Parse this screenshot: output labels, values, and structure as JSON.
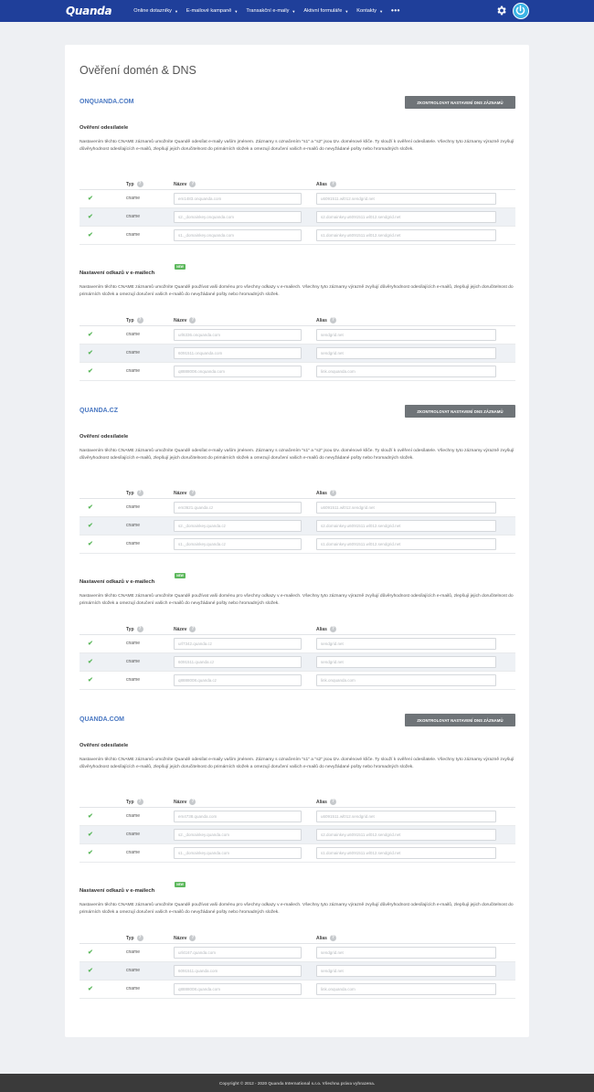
{
  "topbar": {
    "logo": "Quanda",
    "nav": [
      {
        "label": "Online dotazníky"
      },
      {
        "label": "E-mailové kampaně"
      },
      {
        "label": "Transakční e-maily"
      },
      {
        "label": "Aktivní formuláře"
      },
      {
        "label": "Kontakty"
      }
    ],
    "more": "•••"
  },
  "page": {
    "title": "Ověření domén & DNS"
  },
  "labels": {
    "check_button": "ZKONTROLOVAT NASTAVENÍ DNS ZÁZNAMŮ",
    "sender_title": "Ověření odesílatele",
    "sender_desc": "Nastavením těchto CNAME záznamů umožníte Quandě odesílat e-maily vaším jménem. Záznamy s označením \"s1\" a \"s2\" jsou tzv. doménové klíče. Ty slouží k ověření odesílatele. Všechny tyto záznamy výrazně zvyšují důvěryhodnost odesílajících e-mailů, zlepšují jejich doručitelnost do primárních složek a omezují doručení vašich e-mailů do nevyžádané pošty nebo hromadných složek.",
    "links_title": "Nastavení odkazů v e-mailech",
    "links_desc": "Nastavením těchto CNAME záznamů umožníte Quandě používat vaši doménu pro všechny odkazy v e-mailech. Všechny tyto záznamy výrazně zvyšují důvěryhodnost odesílajících e-mailů, zlepšují jejich doručitelnost do primárních složek a omezují doručení vašich e-mailů do nevyžádané pošty nebo hromadných složek.",
    "new_badge": "NEW",
    "col_type": "Typ",
    "col_name": "Název",
    "col_alias": "Alias",
    "help": "?"
  },
  "domains": [
    {
      "name": "ONQUANDA.COM",
      "sender_rows": [
        {
          "type": "cname",
          "name": "em1483.onquanda.com",
          "alias": "u6091511.wl012.sendgrid.net"
        },
        {
          "type": "cname",
          "name": "s2._domainkey.onquanda.com",
          "alias": "s2.domainkey.u6091511.wl012.sendgrid.net"
        },
        {
          "type": "cname",
          "name": "s1._domainkey.onquanda.com",
          "alias": "s1.domainkey.u6091511.wl012.sendgrid.net"
        }
      ],
      "link_rows": [
        {
          "type": "cname",
          "name": "url6336.onquanda.com",
          "alias": "sendgrid.net"
        },
        {
          "type": "cname",
          "name": "6091511.onquanda.com",
          "alias": "sendgrid.net"
        },
        {
          "type": "cname",
          "name": "q8888008.onquanda.com",
          "alias": "link.onquanda.com"
        }
      ]
    },
    {
      "name": "QUANDA.CZ",
      "sender_rows": [
        {
          "type": "cname",
          "name": "em3621.quanda.cz",
          "alias": "u6091511.wl012.sendgrid.net"
        },
        {
          "type": "cname",
          "name": "s2._domainkey.quanda.cz",
          "alias": "s2.domainkey.u6091511.wl012.sendgrid.net"
        },
        {
          "type": "cname",
          "name": "s1._domainkey.quanda.cz",
          "alias": "s1.domainkey.u6091511.wl012.sendgrid.net"
        }
      ],
      "link_rows": [
        {
          "type": "cname",
          "name": "url7342.quanda.cz",
          "alias": "sendgrid.net"
        },
        {
          "type": "cname",
          "name": "6091511.quanda.cz",
          "alias": "sendgrid.net"
        },
        {
          "type": "cname",
          "name": "q8888008.quanda.cz",
          "alias": "link.onquanda.com"
        }
      ]
    },
    {
      "name": "QUANDA.COM",
      "sender_rows": [
        {
          "type": "cname",
          "name": "em4738.quanda.com",
          "alias": "u6091511.wl012.sendgrid.net"
        },
        {
          "type": "cname",
          "name": "s2._domainkey.quanda.com",
          "alias": "s2.domainkey.u6091511.wl012.sendgrid.net"
        },
        {
          "type": "cname",
          "name": "s1._domainkey.quanda.com",
          "alias": "s1.domainkey.u6091511.wl012.sendgrid.net"
        }
      ],
      "link_rows": [
        {
          "type": "cname",
          "name": "url4167.quanda.com",
          "alias": "sendgrid.net"
        },
        {
          "type": "cname",
          "name": "6091511.quanda.com",
          "alias": "sendgrid.net"
        },
        {
          "type": "cname",
          "name": "q8888008.quanda.com",
          "alias": "link.onquanda.com"
        }
      ]
    }
  ],
  "footer": {
    "text": "Copyright © 2012 - 2020 Quanda International s.r.o. Všechna práva vyhrazena."
  },
  "colors": {
    "topbar": "#1f3f9a",
    "accent": "#4a78c2",
    "check": "#5cb85c",
    "button": "#6f7478"
  }
}
